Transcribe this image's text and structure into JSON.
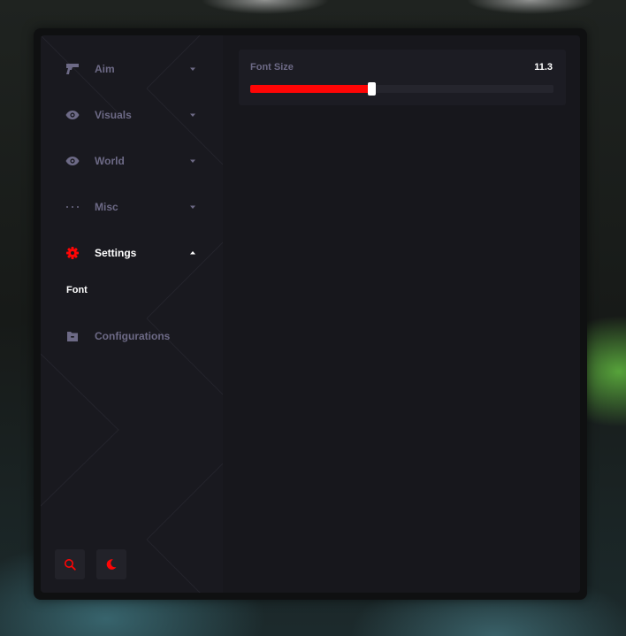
{
  "theme": {
    "accent": "#ff0505",
    "muted_text": "#6d6a86",
    "active_text": "#ffffff",
    "panel_bg": "#17171c",
    "sidebar_bg": "#19191f"
  },
  "sidebar": {
    "items": [
      {
        "label": "Aim",
        "icon": "pistol-icon",
        "expanded": false
      },
      {
        "label": "Visuals",
        "icon": "eye-icon",
        "expanded": false
      },
      {
        "label": "World",
        "icon": "eye-icon",
        "expanded": false
      },
      {
        "label": "Misc",
        "icon": "ellipsis-icon",
        "expanded": false
      },
      {
        "label": "Settings",
        "icon": "gear-icon",
        "expanded": true,
        "active": true
      },
      {
        "label": "Configurations",
        "icon": "folder-icon",
        "expanded": false
      }
    ],
    "settings_subitems": [
      {
        "label": "Font"
      }
    ],
    "bottom_buttons": [
      {
        "icon": "search-icon"
      },
      {
        "icon": "moon-icon"
      }
    ]
  },
  "main": {
    "slider": {
      "label": "Font Size",
      "value_text": "11.3",
      "fill_fraction": 0.4
    }
  }
}
